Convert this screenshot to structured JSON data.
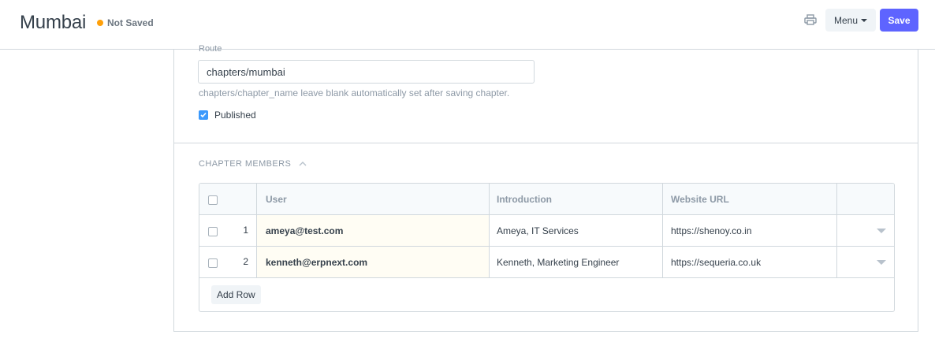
{
  "header": {
    "title": "Mumbai",
    "status": "Not Saved",
    "status_color": "#ffa00a",
    "print_icon": "printer-icon",
    "menu_label": "Menu",
    "save_label": "Save",
    "save_color": "#5e64ff"
  },
  "form": {
    "route_label": "Route",
    "route_value": "chapters/mumbai",
    "route_help": "chapters/chapter_name leave blank automatically set after saving chapter.",
    "published_label": "Published",
    "published_checked": true
  },
  "members_section": {
    "title": "CHAPTER MEMBERS",
    "columns": [
      "User",
      "Introduction",
      "Website URL"
    ],
    "rows": [
      {
        "index": "1",
        "user": "ameya@test.com",
        "introduction": "Ameya, IT Services",
        "website": "https://shenoy.co.in"
      },
      {
        "index": "2",
        "user": "kenneth@erpnext.com",
        "introduction": "Kenneth, Marketing Engineer",
        "website": "https://sequeria.co.uk"
      }
    ],
    "add_row_label": "Add Row"
  }
}
